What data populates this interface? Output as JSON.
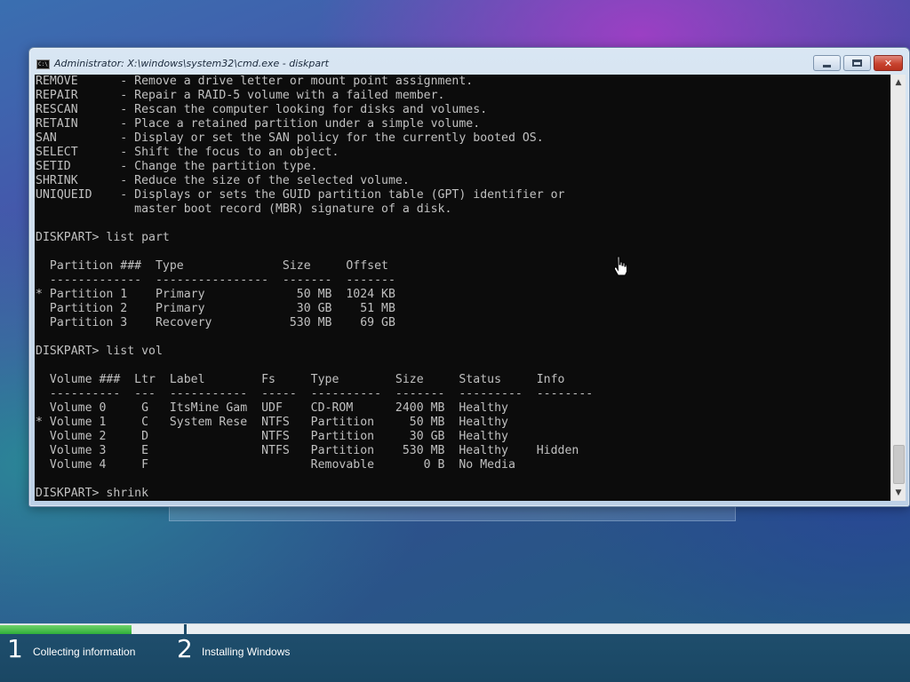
{
  "window": {
    "title": "Administrator: X:\\windows\\system32\\cmd.exe - diskpart",
    "icon_label": "C:\\"
  },
  "console_lines": [
    "REMOVE      - Remove a drive letter or mount point assignment.",
    "REPAIR      - Repair a RAID-5 volume with a failed member.",
    "RESCAN      - Rescan the computer looking for disks and volumes.",
    "RETAIN      - Place a retained partition under a simple volume.",
    "SAN         - Display or set the SAN policy for the currently booted OS.",
    "SELECT      - Shift the focus to an object.",
    "SETID       - Change the partition type.",
    "SHRINK      - Reduce the size of the selected volume.",
    "UNIQUEID    - Displays or sets the GUID partition table (GPT) identifier or",
    "              master boot record (MBR) signature of a disk.",
    "",
    "DISKPART> list part",
    "",
    "  Partition ###  Type              Size     Offset",
    "  -------------  ----------------  -------  -------",
    "* Partition 1    Primary             50 MB  1024 KB",
    "  Partition 2    Primary             30 GB    51 MB",
    "  Partition 3    Recovery           530 MB    69 GB",
    "",
    "DISKPART> list vol",
    "",
    "  Volume ###  Ltr  Label        Fs     Type        Size     Status     Info",
    "  ----------  ---  -----------  -----  ----------  -------  ---------  --------",
    "  Volume 0     G   ItsMine Gam  UDF    CD-ROM      2400 MB  Healthy",
    "* Volume 1     C   System Rese  NTFS   Partition     50 MB  Healthy",
    "  Volume 2     D                NTFS   Partition     30 GB  Healthy",
    "  Volume 3     E                NTFS   Partition    530 MB  Healthy    Hidden",
    "  Volume 4     F                       Removable       0 B  No Media",
    "",
    "DISKPART> shrink"
  ],
  "setup_progress": {
    "fill_fraction": 0.145,
    "steps": [
      {
        "number": "1",
        "label": "Collecting information"
      },
      {
        "number": "2",
        "label": "Installing Windows"
      }
    ]
  },
  "colors": {
    "console_bg": "#0c0c0c",
    "console_text": "#c0c0c0",
    "progress_fill": "#2fae3a",
    "footer_bg": "#1f4f6e"
  }
}
